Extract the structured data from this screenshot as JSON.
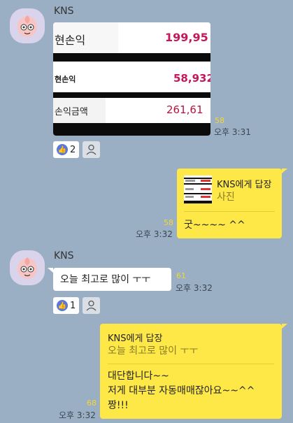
{
  "messages": {
    "m1": {
      "sender": "KNS",
      "photo": {
        "row1_label": "현손익",
        "row1_value": "199,95",
        "row2_label": "현손익",
        "row2_value": "58,932",
        "row3_label": "손익금액",
        "row3_value": "261,61"
      },
      "unread": "58",
      "time": "오후 3:31",
      "reaction_count": "2"
    },
    "m2": {
      "reply_title": "KNS에게 답장",
      "reply_sub": "사진",
      "text": "굿~~~~ ^^",
      "unread": "58",
      "time": "오후 3:32"
    },
    "m3": {
      "sender": "KNS",
      "text": "오늘 최고로 많이 ㅜㅜ",
      "unread": "61",
      "time": "오후 3:32",
      "reaction_count": "1"
    },
    "m4": {
      "reply_title": "KNS에게 답장",
      "reply_sub": "오늘 최고로 많이 ㅜㅜ",
      "line1": "대단합니다~~",
      "line2": "저게 대부분 자동매매잖아요~~^^",
      "line3": "짱!!!",
      "unread": "68",
      "time": "오후 3:32"
    }
  },
  "colors": {
    "background": "#9bafc4",
    "my_bubble": "#fde847",
    "their_bubble": "#ffffff",
    "unread": "#f2d635",
    "profit_value": "#c5185a"
  },
  "icons": {
    "reaction": "thumbs-up-icon",
    "members": "person-icon",
    "avatar": "peach-character-icon"
  }
}
